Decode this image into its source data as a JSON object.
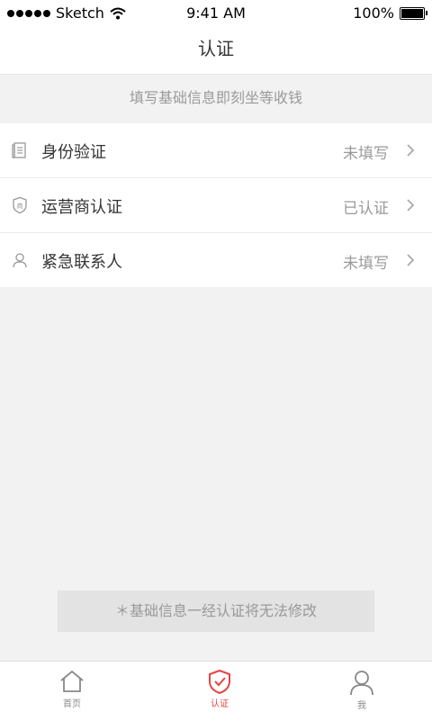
{
  "status_bar": {
    "carrier": "Sketch",
    "time": "9:41 AM",
    "battery": "100%"
  },
  "nav": {
    "title": "认证"
  },
  "hint": "填写基础信息即刻坐等收钱",
  "items": [
    {
      "label": "身份验证",
      "value": "未填写",
      "icon": "id-document-icon"
    },
    {
      "label": "运营商认证",
      "value": "已认证",
      "icon": "carrier-shield-icon"
    },
    {
      "label": "紧急联系人",
      "value": "未填写",
      "icon": "person-icon"
    }
  ],
  "notice": "＊基础信息一经认证将无法修改",
  "tabs": [
    {
      "label": "首页",
      "icon": "home-icon",
      "active": false
    },
    {
      "label": "认证",
      "icon": "shield-check-icon",
      "active": true
    },
    {
      "label": "我",
      "icon": "profile-icon",
      "active": false
    }
  ],
  "colors": {
    "accent": "#e64545",
    "background": "#f2f2f2",
    "muted_text": "#9a9a9a"
  }
}
